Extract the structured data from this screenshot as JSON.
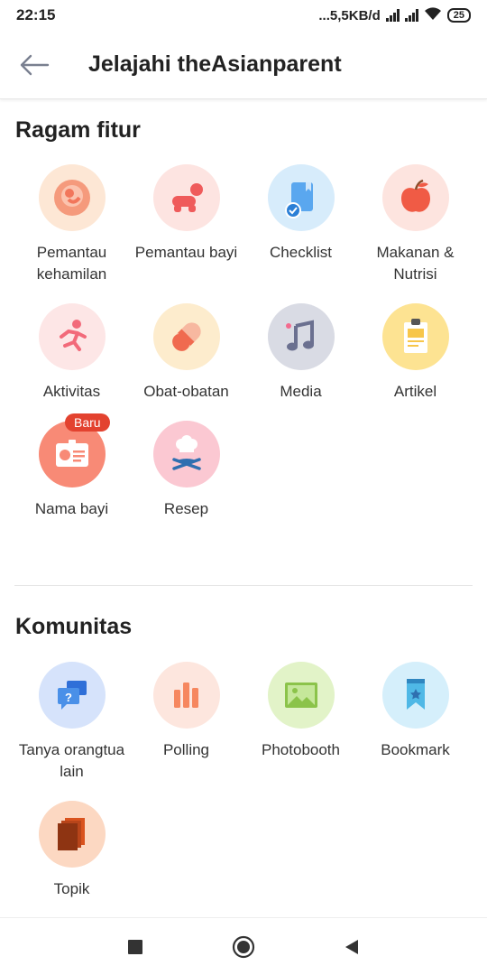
{
  "status": {
    "time": "22:15",
    "speed": "...5,5KB/d",
    "battery": "25"
  },
  "appbar": {
    "title": "Jelajahi theAsianparent"
  },
  "ragam": {
    "title": "Ragam fitur",
    "items": [
      {
        "label": "Pemantau kehamilan",
        "icon": "pregnancy-icon",
        "bg": "#fde7d5"
      },
      {
        "label": "Pemantau bayi",
        "icon": "crawling-baby-icon",
        "bg": "#fde4e1"
      },
      {
        "label": "Checklist",
        "icon": "checklist-icon",
        "bg": "#d7ecfb"
      },
      {
        "label": "Makanan & Nutrisi",
        "icon": "apple-icon",
        "bg": "#fde4df"
      },
      {
        "label": "Aktivitas",
        "icon": "running-icon",
        "bg": "#fde6e6"
      },
      {
        "label": "Obat-obatan",
        "icon": "pill-icon",
        "bg": "#fdeccd"
      },
      {
        "label": "Media",
        "icon": "music-note-icon",
        "bg": "#d9dbe4"
      },
      {
        "label": "Artikel",
        "icon": "clipboard-icon",
        "bg": "#fde392"
      },
      {
        "label": "Nama bayi",
        "icon": "name-card-icon",
        "bg": "#f88a76",
        "badge": "Baru"
      },
      {
        "label": "Resep",
        "icon": "chef-icon",
        "bg": "#fbc8d2"
      }
    ]
  },
  "komunitas": {
    "title": "Komunitas",
    "items": [
      {
        "label": "Tanya orangtua lain",
        "icon": "chat-question-icon",
        "bg": "#d6e3fb"
      },
      {
        "label": "Polling",
        "icon": "bar-chart-icon",
        "bg": "#fde6de"
      },
      {
        "label": "Photobooth",
        "icon": "picture-icon",
        "bg": "#e2f3c8"
      },
      {
        "label": "Bookmark",
        "icon": "bookmark-icon",
        "bg": "#d5effb"
      },
      {
        "label": "Topik",
        "icon": "stack-icon",
        "bg": "#fcd8c2"
      }
    ]
  }
}
